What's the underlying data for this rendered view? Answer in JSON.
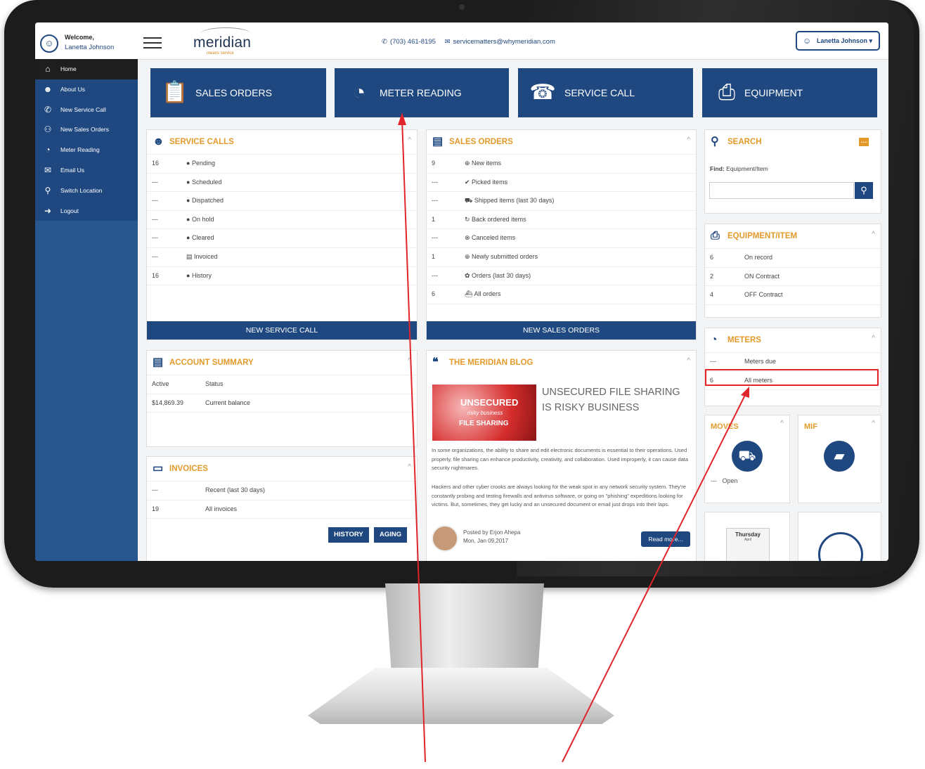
{
  "header": {
    "welcome": "Welcome,",
    "user_name": "Lanetta Johnson",
    "logo": "meridian",
    "logo_tagline": "means service",
    "phone": "(703) 461-8195",
    "email": "servicematters@whymeridian.com",
    "user_menu": "Lanetta Johnson"
  },
  "sidebar": {
    "items": [
      {
        "label": "Home",
        "icon": "home-icon"
      },
      {
        "label": "About Us",
        "icon": "user-icon"
      },
      {
        "label": "New Service Call",
        "icon": "phone-icon"
      },
      {
        "label": "New Sales Orders",
        "icon": "sales-icon"
      },
      {
        "label": "Meter Reading",
        "icon": "gauge-icon"
      },
      {
        "label": "Email Us",
        "icon": "envelope-icon"
      },
      {
        "label": "Switch Location",
        "icon": "location-icon"
      },
      {
        "label": "Logout",
        "icon": "logout-icon"
      }
    ]
  },
  "tiles": {
    "sales_orders": "SALES ORDERS",
    "meter_reading": "METER READING",
    "service_call": "SERVICE CALL",
    "equipment": "EQUIPMENT"
  },
  "service_calls": {
    "title": "SERVICE CALLS",
    "rows": [
      {
        "count": "16",
        "label": "Pending"
      },
      {
        "count": "---",
        "label": "Scheduled"
      },
      {
        "count": "---",
        "label": "Dispatched"
      },
      {
        "count": "---",
        "label": "On hold"
      },
      {
        "count": "---",
        "label": "Cleared"
      },
      {
        "count": "---",
        "label": "Invoiced"
      },
      {
        "count": "16",
        "label": "History"
      }
    ],
    "button": "NEW SERVICE CALL"
  },
  "sales_orders": {
    "title": "SALES ORDERS",
    "rows": [
      {
        "count": "9",
        "label": "New items"
      },
      {
        "count": "---",
        "label": "Picked items"
      },
      {
        "count": "---",
        "label": "Shipped items (last 30 days)"
      },
      {
        "count": "1",
        "label": "Back ordered items"
      },
      {
        "count": "---",
        "label": "Canceled items"
      },
      {
        "count": "1",
        "label": "Newly submitted orders"
      },
      {
        "count": "---",
        "label": "Orders (last 30 days)"
      },
      {
        "count": "6",
        "label": "All orders"
      }
    ],
    "button": "NEW SALES ORDERS"
  },
  "search": {
    "title": "SEARCH",
    "find_label": "Find:",
    "find_value": "Equipment/Item"
  },
  "equipment_item": {
    "title": "EQUIPMENT/ITEM",
    "rows": [
      {
        "count": "6",
        "label": "On record"
      },
      {
        "count": "2",
        "label": "ON Contract"
      },
      {
        "count": "4",
        "label": "OFF Contract"
      }
    ]
  },
  "meters": {
    "title": "METERS",
    "rows": [
      {
        "count": "---",
        "label": "Meters due"
      },
      {
        "count": "6",
        "label": "All meters"
      }
    ]
  },
  "account_summary": {
    "title": "ACCOUNT SUMMARY",
    "rows": [
      {
        "value": "Active",
        "label": "Status"
      },
      {
        "value": "$14,869.39",
        "label": "Current balance"
      }
    ]
  },
  "invoices": {
    "title": "INVOICES",
    "rows": [
      {
        "count": "---",
        "label": "Recent (last 30 days)"
      },
      {
        "count": "19",
        "label": "All invoices"
      }
    ],
    "history_button": "HISTORY",
    "aging_button": "AGING"
  },
  "blog": {
    "title": "THE MERIDIAN BLOG",
    "image_line1": "UNSECURED",
    "image_line2": "risky business",
    "image_line3": "FILE SHARING",
    "post_title": "UNSECURED FILE SHARING IS RISKY BUSINESS",
    "paragraph1": "In some organizations, the ability to share and edit electronic documents is essential to their operations. Used properly, file sharing can enhance productivity, creativity, and collaboration. Used improperly, it can cause data security nightmares.",
    "paragraph2": "Hackers and other cyber crooks are always looking for the weak spot in any network security system. They're constantly probing and testing firewalls and antivirus software, or going on \"phishing\" expeditions looking for victims. But, sometimes, they get lucky and an unsecured document or email just drops into their laps.",
    "posted_by": "Posted by Erjon Ahepa",
    "date": "Mon, Jan 09,2017",
    "read_more": "Read more..."
  },
  "moves": {
    "title": "MOVES",
    "count": "---",
    "label": "Open"
  },
  "mif": {
    "title": "MIF"
  },
  "calendar": {
    "day": "Thursday",
    "month": "April"
  },
  "colors": {
    "brand": "#1f4880",
    "accent": "#e39a2a",
    "annotation": "#e0252b"
  }
}
